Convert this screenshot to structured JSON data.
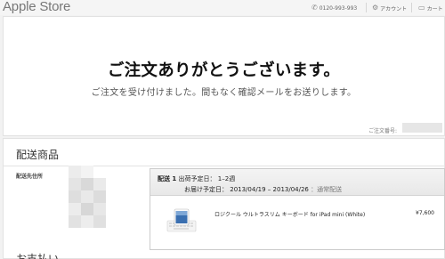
{
  "header": {
    "logo_text": "Apple Store",
    "phone": "0120-993-993",
    "account_label": "アカウント",
    "cart_label": "カート"
  },
  "confirmation": {
    "headline": "ご注文ありがとうございます。",
    "message": "ご注文を受け付けました。間もなく確認メールをお送りします。",
    "order_number_label": "ご注文番号:"
  },
  "shipping": {
    "section_title": "配送商品",
    "address_label": "配送先住所",
    "shipment_label": "配送 1",
    "ship_date_label": "出荷予定日：",
    "ship_date_value": "1–2週",
    "delivery_label": "お届け予定日：",
    "delivery_range": "2013/04/19 – 2013/04/26",
    "delivery_method": "：通常配送",
    "items": [
      {
        "name": "ロジクール ウルトラスリム キーボード for iPad mini (White)",
        "price": "¥7,600"
      }
    ]
  },
  "next_section": {
    "title": "お支払い"
  },
  "colors": {
    "background": "#f2f2f2",
    "panel": "#ffffff",
    "card_header": "#ececec",
    "text": "#333333"
  }
}
